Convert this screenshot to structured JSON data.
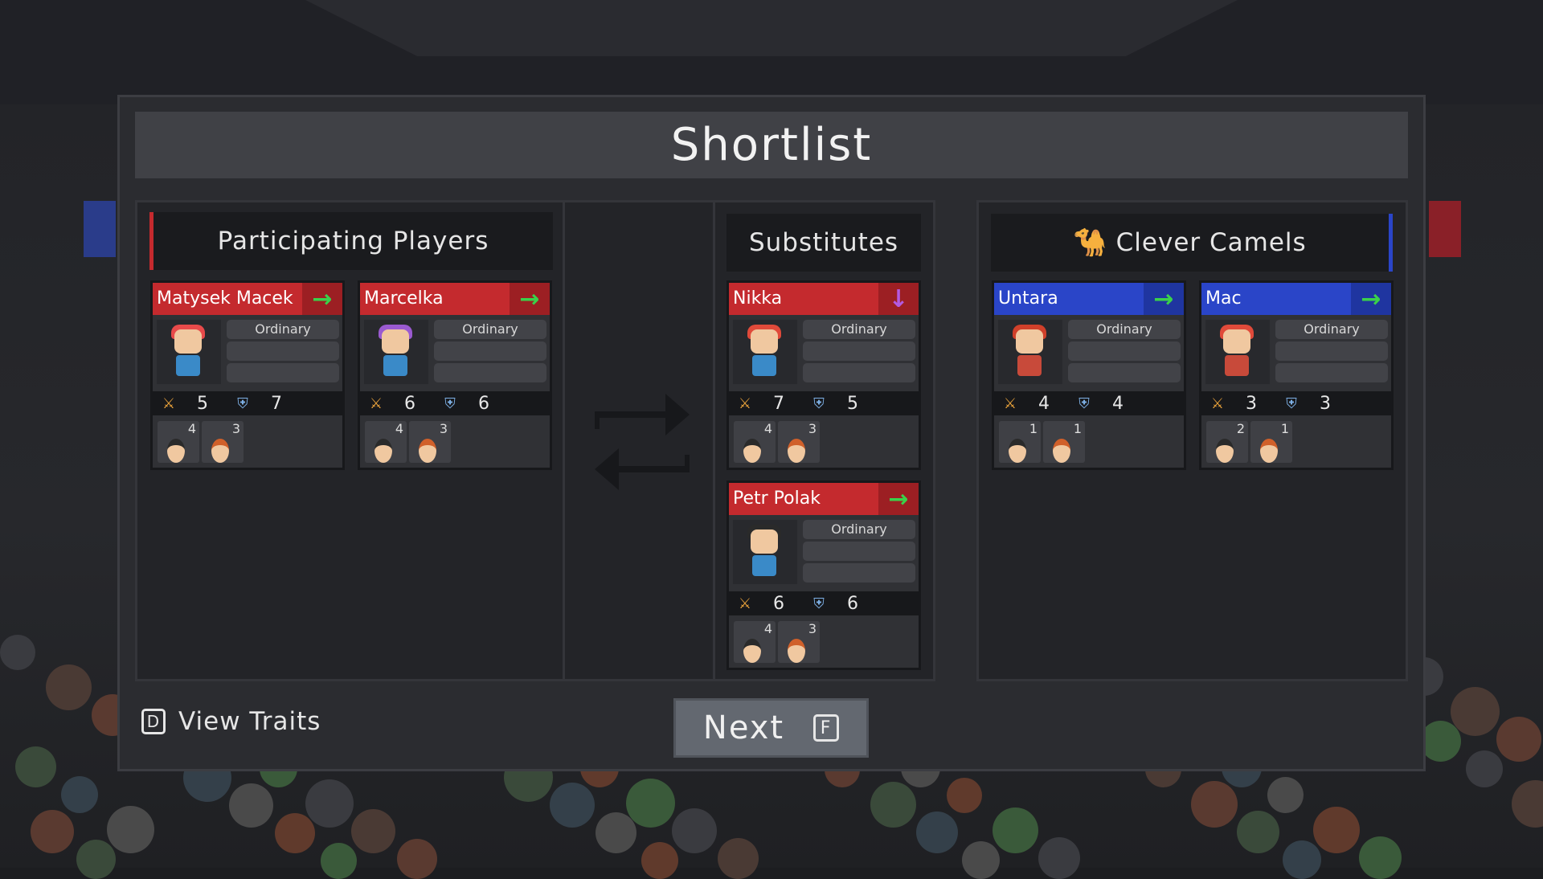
{
  "title": "Shortlist",
  "columns": {
    "participating": {
      "label": "Participating Players"
    },
    "substitutes": {
      "label": "Substitutes"
    },
    "opponent": {
      "label": "Clever Camels",
      "icon": "camel-icon"
    }
  },
  "participating_players": [
    {
      "name": "Matysek Macek",
      "trait": "Ordinary",
      "attack": "5",
      "defense": "7",
      "mini": [
        "4",
        "3"
      ],
      "action": "→"
    },
    {
      "name": "Marcelka",
      "trait": "Ordinary",
      "attack": "6",
      "defense": "6",
      "mini": [
        "4",
        "3"
      ],
      "action": "→"
    }
  ],
  "substitutes": [
    {
      "name": "Nikka",
      "trait": "Ordinary",
      "attack": "7",
      "defense": "5",
      "mini": [
        "4",
        "3"
      ],
      "action": "↓"
    },
    {
      "name": "Petr Polak",
      "trait": "Ordinary",
      "attack": "6",
      "defense": "6",
      "mini": [
        "4",
        "3"
      ],
      "action": "→"
    }
  ],
  "opponent_players": [
    {
      "name": "Untara",
      "trait": "Ordinary",
      "attack": "4",
      "defense": "4",
      "mini": [
        "1",
        "1"
      ],
      "action": "→"
    },
    {
      "name": "Mac",
      "trait": "Ordinary",
      "attack": "3",
      "defense": "3",
      "mini": [
        "2",
        "1"
      ],
      "action": "→"
    }
  ],
  "footer": {
    "view_traits_key": "D",
    "view_traits_label": "View Traits",
    "next_label": "Next",
    "next_key": "F"
  },
  "colors": {
    "team_red": "#c42a2e",
    "team_blue": "#2a45c8",
    "arrow_green": "#3ad14a",
    "arrow_purple": "#b35ae0"
  }
}
